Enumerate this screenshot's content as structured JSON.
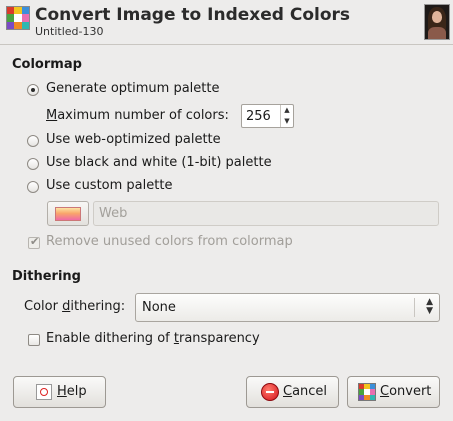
{
  "header": {
    "title": "Convert Image to Indexed Colors",
    "subtitle": "Untitled-130",
    "icon_colors": [
      "#d93a2b",
      "#f2c51f",
      "#3b8fd9",
      "#49a33f",
      "#ffffff",
      "#e86fb0",
      "#7b4bc4",
      "#f08a24",
      "#2fb8b0"
    ]
  },
  "colormap": {
    "section_title": "Colormap",
    "options": [
      {
        "label": "Generate optimum palette",
        "checked": true
      },
      {
        "label": "Use web-optimized palette",
        "checked": false
      },
      {
        "label": "Use black and white (1-bit) palette",
        "checked": false
      },
      {
        "label": "Use custom palette",
        "checked": false
      }
    ],
    "max_colors": {
      "label_prefix": "M",
      "label_rest": "aximum number of colors:",
      "value": "256"
    },
    "custom_palette": {
      "value": "Web"
    },
    "remove_unused": {
      "label": "Remove unused colors from colormap",
      "checked": true,
      "enabled": false
    }
  },
  "dithering": {
    "section_title": "Dithering",
    "color_dithering": {
      "label_a": "Color ",
      "label_u": "d",
      "label_b": "ithering:",
      "value": "None"
    },
    "transparency": {
      "label_a": "Enable dithering of ",
      "label_u": "t",
      "label_b": "ransparency",
      "checked": false
    }
  },
  "buttons": {
    "help": {
      "u": "H",
      "rest": "elp"
    },
    "cancel": {
      "u": "C",
      "rest": "ancel"
    },
    "convert": {
      "u": "C",
      "rest": "onvert"
    }
  }
}
